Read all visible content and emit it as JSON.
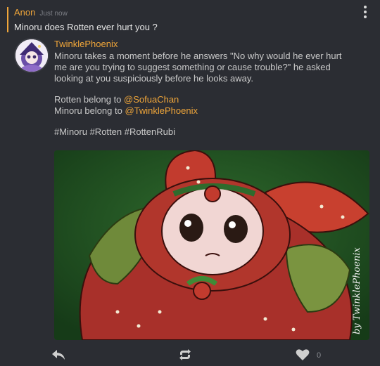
{
  "ask": {
    "name": "Anon",
    "time": "Just now",
    "question": "Minoru does Rotten ever hurt you ?"
  },
  "answer": {
    "author": "TwinklePhoenix",
    "line1": "Minoru takes a moment before he answers \"No why would he ever hurt",
    "line2": "me are you trying to suggest something or cause trouble?\" he asked",
    "line3": "looking at you suspiciously before he looks away.",
    "credit1_prefix": "Rotten belong to ",
    "credit1_mention": "@SofuaChan",
    "credit2_prefix": "Minoru belong to ",
    "credit2_mention": "@TwinklePhoenix",
    "tags": "#Minoru #Rotten #RottenRubi",
    "image_signature": "by TwinklePhoenix"
  },
  "footer": {
    "like_count": "0",
    "icons": [
      "reply-arrow-icon",
      "repost-icon",
      "heart-icon"
    ]
  },
  "colors": {
    "background": "#2b2d33",
    "accent": "#f0a63a",
    "text": "#d6d6d6"
  }
}
